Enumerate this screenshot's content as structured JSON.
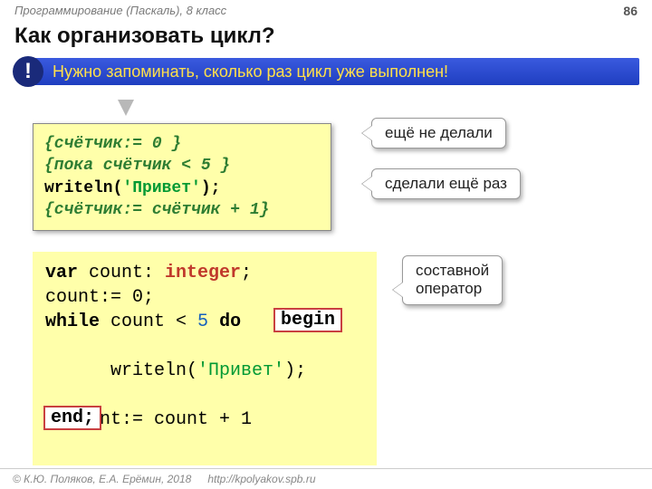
{
  "header": {
    "course": "Программирование (Паскаль), 8 класс",
    "page_number": "86",
    "title": "Как организовать цикл?"
  },
  "alert": {
    "icon": "!",
    "text": "Нужно запоминать, сколько раз цикл уже выполнен!"
  },
  "callouts": {
    "not_yet": "ещё не делали",
    "did_again": "сделали ещё раз",
    "compound": "составной\nоператор"
  },
  "code_pseudo": {
    "line1": "{счётчик:= 0 }",
    "line2": "{пока счётчик < 5 }",
    "line3_a": "  writeln(",
    "line3_str": "'Привет'",
    "line3_b": ");",
    "line4": "  {счётчик:= счётчик + 1}"
  },
  "code_pascal": {
    "l1_a": "var",
    "l1_b": " count: ",
    "l1_c": "integer",
    "l1_d": ";",
    "l2": "count:= 0;",
    "l3_a": "while",
    "l3_b": " count < ",
    "l3_num": "5",
    "l3_c": " ",
    "l3_d": "do",
    "l4_a": "  writeln(",
    "l4_str": "'Привет'",
    "l4_b": ");",
    "l5": "  count:= count + 1"
  },
  "tags": {
    "begin": "begin",
    "end": "end;"
  },
  "footer": {
    "copyright": "© К.Ю. Поляков, Е.А. Ерёмин, 2018",
    "url": "http://kpolyakov.spb.ru"
  }
}
